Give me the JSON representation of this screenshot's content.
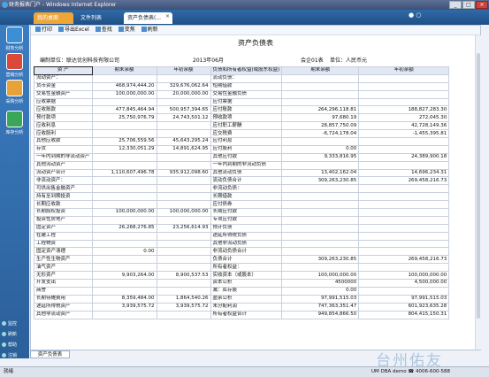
{
  "window": {
    "title": "财务报表门户 - Windows Internet Explorer",
    "controls": [
      "_",
      "□",
      "×"
    ]
  },
  "tabs": [
    {
      "label": "我的桌面"
    },
    {
      "label": "文件列表"
    },
    {
      "label": "资产负债表(..."
    }
  ],
  "tab_close": "×",
  "top_icons": "● ○",
  "sidebar": {
    "items": [
      {
        "label": "财务分析",
        "color": "#3a8fd6"
      },
      {
        "label": "营销分析",
        "color": "#d84a3a"
      },
      {
        "label": "采购分析",
        "color": "#e8a23a"
      },
      {
        "label": "库存分析",
        "color": "#3aa65a"
      }
    ],
    "bottom": [
      {
        "label": "监控"
      },
      {
        "label": "刷新"
      },
      {
        "label": "帮助"
      },
      {
        "label": "注销"
      }
    ]
  },
  "toolbar": {
    "print": "打印",
    "export": "导出Excel",
    "find": "查找",
    "zoom": "变焦",
    "refresh": "刷新"
  },
  "report": {
    "title": "资产负债表",
    "org": "编制单位：联达优创科技有限公司",
    "date": "2013年06月",
    "form": "会企01表",
    "unit": "单位：人民币元",
    "headers": [
      "资    产",
      "期末余额",
      "年初余额",
      "负债和所有者权益(或股东权益)",
      "期末余额",
      "年初余额"
    ],
    "rows": [
      [
        "流动资产：",
        "",
        "",
        "流动负债：",
        "",
        ""
      ],
      [
        "货币资金",
        "468,974,444.20",
        "329,676,062.64",
        "短期借款",
        "",
        ""
      ],
      [
        "交易性金融资产",
        "100,000,000.00",
        "20,000,000.00",
        "交易性金融负债",
        "",
        ""
      ],
      [
        "应收票据",
        "",
        "",
        "应付票据",
        "",
        ""
      ],
      [
        "应收账款",
        "477,845,464.94",
        "500,957,394.65",
        "应付账款",
        "264,296,118.81",
        "188,827,283.30"
      ],
      [
        "预付款项",
        "25,750,976.79",
        "24,743,501.12",
        "预收款项",
        "97,680.19",
        "272,045.30"
      ],
      [
        "应收利息",
        "",
        "",
        "应付职工薪酬",
        "28,857,750.09",
        "42,728,149.36"
      ],
      [
        "应收股利",
        "",
        "",
        "应交税费",
        "-6,724,178.04",
        "-1,455,395.81"
      ],
      [
        "其他应收款",
        "25,706,559.56",
        "45,643,295.24",
        "应付利息",
        "",
        ""
      ],
      [
        "存货",
        "12,330,051.29",
        "14,891,624.95",
        "应付股利",
        "0.00",
        ""
      ],
      [
        "一年内到期的非流动资产",
        "",
        "",
        "其他应付款",
        "9,333,816.95",
        "24,389,900.18"
      ],
      [
        "其他流动资产",
        "",
        "",
        "一年内到期的非流动负债",
        "",
        ""
      ],
      [
        "流动资产合计",
        "1,110,607,496.78",
        "935,912,098.60",
        "其他流动负债",
        "13,402,162.04",
        "14,696,234.31"
      ],
      [
        "非流动资产：",
        "",
        "",
        "流动负债合计",
        "309,263,230.85",
        "269,458,216.73"
      ],
      [
        "可供出售金融资产",
        "",
        "",
        "非流动负债：",
        "",
        ""
      ],
      [
        "持有至到期投资",
        "",
        "",
        "长期借款",
        "",
        ""
      ],
      [
        "长期应收款",
        "",
        "",
        "应付债券",
        "",
        ""
      ],
      [
        "长期股权投资",
        "100,000,000.00",
        "100,000,000.00",
        "长期应付款",
        "",
        ""
      ],
      [
        "投资性房地产",
        "",
        "",
        "专项应付款",
        "",
        ""
      ],
      [
        "固定资产",
        "26,268,276.85",
        "23,256,614.93",
        "预计负债",
        "",
        ""
      ],
      [
        "在建工程",
        "",
        "",
        "递延所得税负债",
        "",
        ""
      ],
      [
        "工程物资",
        "",
        "",
        "其他非流动负债",
        "",
        ""
      ],
      [
        "固定资产清理",
        "0.00",
        "",
        "非流动负债合计",
        "",
        ""
      ],
      [
        "生产性生物资产",
        "",
        "",
        "负债合计",
        "309,263,230.85",
        "269,458,216.73"
      ],
      [
        "油气资产",
        "",
        "",
        "所有者权益：",
        "",
        ""
      ],
      [
        "无形资产",
        "9,903,264.00",
        "8,900,537.53",
        "实收资本（或股本）",
        "100,000,000.00",
        "100,000,000.00"
      ],
      [
        "开发支出",
        "",
        "",
        "资本公积",
        "4500000",
        "4,500,000.00"
      ],
      [
        "商誉",
        "",
        "",
        "减：库存股",
        "0.00",
        ""
      ],
      [
        "长期待摊费用",
        "8,359,484.00",
        "1,864,540.26",
        "盈余公积",
        "97,991,515.03",
        "97,991,515.03"
      ],
      [
        "递延所得税资产",
        "3,939,575.72",
        "3,939,575.72",
        "未分配利润",
        "747,363,351.47",
        "601,923,635.28"
      ],
      [
        "其他非流动资产",
        "",
        "",
        "所有者权益合计",
        "949,854,866.50",
        "804,415,150.31"
      ]
    ]
  },
  "bottom_tab": "资产负债表",
  "status": {
    "left": "就绪",
    "right": "UM DBA  demo  ☎ 4006-600-588"
  },
  "watermark": "台州佑友"
}
